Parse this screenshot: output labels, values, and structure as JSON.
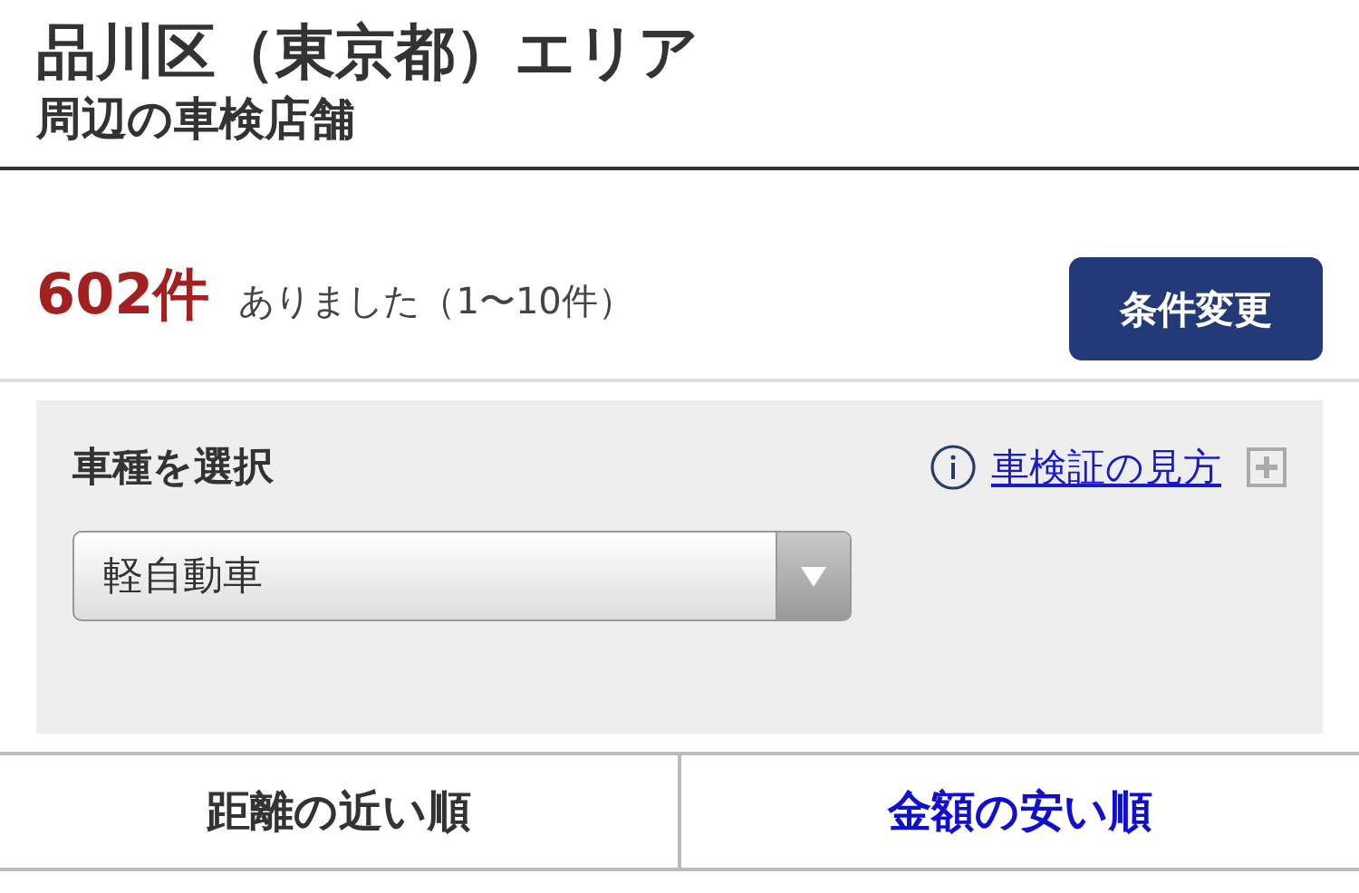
{
  "header": {
    "title": "品川区（東京都）エリア",
    "subtitle": "周辺の車検店舗"
  },
  "results": {
    "count": "602件",
    "text": "ありました（1〜10件）",
    "button": "条件変更"
  },
  "panel": {
    "label": "車種を選択",
    "help_link": "車検証の見方",
    "select": {
      "value": "軽自動車"
    }
  },
  "sort_tabs": [
    {
      "label": "距離の近い順",
      "selected": true
    },
    {
      "label": "金額の安い順",
      "selected": false
    }
  ]
}
